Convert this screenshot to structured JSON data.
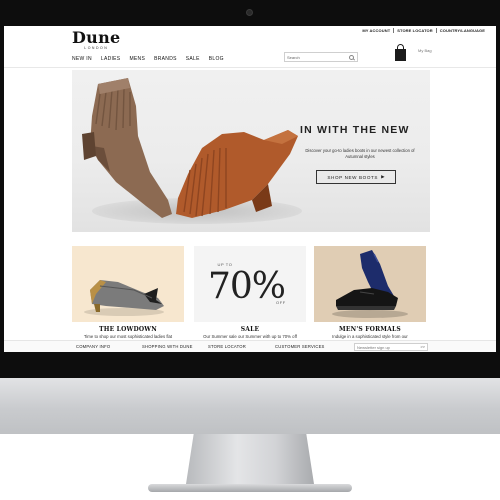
{
  "utility_bar": {
    "account": "MY ACCOUNT",
    "store_locator": "STORE LOCATOR",
    "country_language": "COUNTRY/LANGUAGE"
  },
  "logo": {
    "main": "Dune",
    "sub": "LONDON"
  },
  "nav": {
    "items": [
      "NEW IN",
      "LADIES",
      "MENS",
      "BRANDS",
      "SALE",
      "BLOG"
    ]
  },
  "search": {
    "placeholder": "Search"
  },
  "bag": {
    "label": "My Bag"
  },
  "hero": {
    "title": "IN WITH THE NEW",
    "description": "Discover your go-to ladies boots in our newest collection of Autumnal styles",
    "cta": "SHOP NEW BOOTS",
    "cta_arrow": "▶"
  },
  "tiles": [
    {
      "title": "THE LOWDOWN",
      "subtitle": "Time to shop our most sophisticated ladies flat"
    },
    {
      "title": "SALE",
      "subtitle": "Our Summer sale our Summer with up to 70% off",
      "upto": "UP TO",
      "percent": "70%",
      "off": "OFF"
    },
    {
      "title": "MEN'S FORMALS",
      "subtitle": "Indulge in a sophisticated style from our"
    }
  ],
  "footer": {
    "links": [
      "COMPANY INFO",
      "SHOPPING WITH DUNE",
      "STORE LOCATOR",
      "CUSTOMER SERVICES"
    ],
    "newsletter_placeholder": "Newsletter sign up",
    "newsletter_go": ">>"
  },
  "colors": {
    "monitor_bezel": "#0d0d0d",
    "hero_bg": "#ececec",
    "tan_boot": "#8c6a52",
    "rust_boot": "#b05a2b",
    "tile_cream": "#f7e7cf",
    "tile_beige": "#e0cdb4",
    "navy_shoe": "#1d2c6b"
  }
}
